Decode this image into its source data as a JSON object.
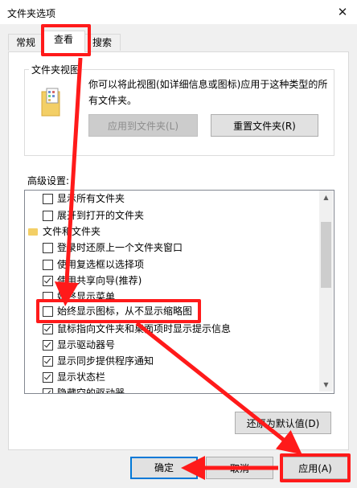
{
  "window": {
    "title": "文件夹选项",
    "close": "✕"
  },
  "tabs": [
    {
      "label": "常规"
    },
    {
      "label": "查看"
    },
    {
      "label": "搜索"
    }
  ],
  "folder_view": {
    "title": "文件夹视图",
    "description": "你可以将此视图(如详细信息或图标)应用于这种类型的所有文件夹。",
    "apply_button": "应用到文件夹(L)",
    "reset_button": "重置文件夹(R)"
  },
  "advanced": {
    "label": "高级设置:",
    "items": [
      {
        "label": "显示所有文件夹",
        "checked": false
      },
      {
        "label": "展开到打开的文件夹",
        "checked": false
      },
      {
        "label": "文件和文件夹",
        "folder": true
      },
      {
        "label": "登录时还原上一个文件夹窗口",
        "checked": false
      },
      {
        "label": "使用复选框以选择项",
        "checked": false
      },
      {
        "label": "使用共享向导(推荐)",
        "checked": true
      },
      {
        "label": "始终显示菜单",
        "checked": false
      },
      {
        "label": "始终显示图标，从不显示缩略图",
        "checked": false
      },
      {
        "label": "鼠标指向文件夹和桌面项时显示提示信息",
        "checked": true
      },
      {
        "label": "显示驱动器号",
        "checked": true
      },
      {
        "label": "显示同步提供程序通知",
        "checked": true
      },
      {
        "label": "显示状态栏",
        "checked": true
      },
      {
        "label": "隐藏空的驱动器",
        "checked": true
      }
    ]
  },
  "restore_button": "还原为默认值(D)",
  "footer": {
    "ok": "确定",
    "cancel": "取消",
    "apply": "应用(A)"
  },
  "colors": {
    "highlight": "#ff1a1a",
    "focus": "#0078d7"
  }
}
